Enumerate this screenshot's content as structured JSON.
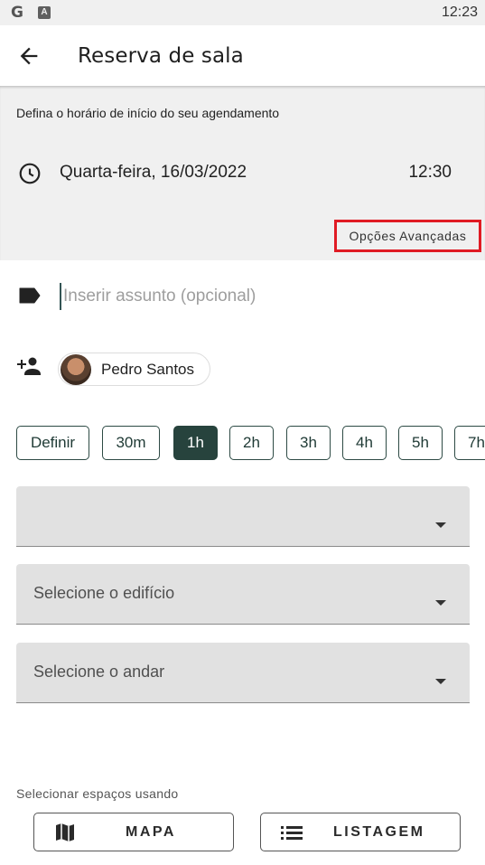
{
  "status_bar": {
    "left_icons": [
      "google-g-icon",
      "font-a-icon"
    ],
    "g_glyph": "G",
    "a_glyph": "A",
    "time": "12:23"
  },
  "app_bar": {
    "back_icon": "arrow-left-icon",
    "title": "Reserva de sala"
  },
  "schedule": {
    "label": "Defina o horário de início do seu agendamento",
    "clock_icon": "clock-icon",
    "date": "Quarta-feira, 16/03/2022",
    "time": "12:30",
    "advanced_button": "Opções Avançadas",
    "highlight_color": "#e01b24"
  },
  "subject": {
    "icon": "label-tag-icon",
    "value": "",
    "placeholder": "Inserir assunto (opcional)"
  },
  "participants": {
    "add_icon": "person-add-icon",
    "people": [
      {
        "name": "Pedro Santos",
        "avatar": "avatar-photo"
      }
    ]
  },
  "durations": {
    "options": [
      "Definir",
      "30m",
      "1h",
      "2h",
      "3h",
      "4h",
      "5h",
      "7h"
    ],
    "selected": "1h",
    "accent_color": "#27433d"
  },
  "selects": {
    "first": {
      "value": ""
    },
    "building": {
      "placeholder": "Selecione o edifício"
    },
    "floor": {
      "placeholder": "Selecione o andar"
    }
  },
  "space_mode": {
    "label": "Selecionar espaços usando",
    "map_button": {
      "label": "MAPA",
      "icon": "map-icon"
    },
    "list_button": {
      "label": "LISTAGEM",
      "icon": "list-icon"
    }
  }
}
